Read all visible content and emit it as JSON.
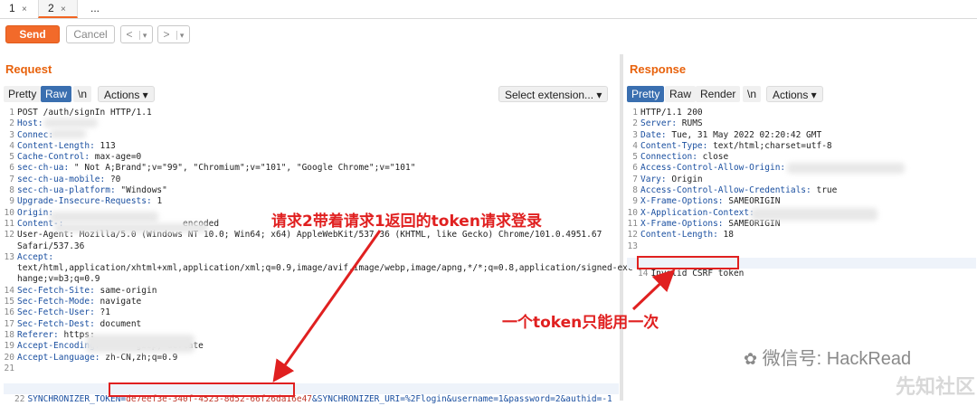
{
  "tabs": [
    {
      "label": "1",
      "close": "×"
    },
    {
      "label": "2",
      "close": "×"
    },
    {
      "label": "..."
    }
  ],
  "toolbar": {
    "send_label": "Send",
    "cancel_label": "Cancel",
    "back_glyph": "<",
    "fwd_glyph": ">",
    "menu_glyph": "▾"
  },
  "request": {
    "title": "Request",
    "view_tabs": [
      "Pretty",
      "Raw",
      "\\n"
    ],
    "actions_label": "Actions ▾",
    "select_extension_label": "Select extension... ▾",
    "lines": [
      {
        "n": "1",
        "k": "",
        "v": "POST /auth/signIn HTTP/1.1"
      },
      {
        "n": "2",
        "k": "Host",
        "v": ""
      },
      {
        "n": "3",
        "k": "Connec",
        "v": ""
      },
      {
        "n": "4",
        "k": "Content-Length",
        "v": " 113"
      },
      {
        "n": "5",
        "k": "Cache-Control",
        "v": " max-age=0"
      },
      {
        "n": "6",
        "k": "sec-ch-ua",
        "v": " \" Not A;Brand\";v=\"99\", \"Chromium\";v=\"101\", \"Google Chrome\";v=\"101\""
      },
      {
        "n": "7",
        "k": "sec-ch-ua-mobile",
        "v": " ?0"
      },
      {
        "n": "8",
        "k": "sec-ch-ua-platform",
        "v": " \"Windows\""
      },
      {
        "n": "9",
        "k": "Upgrade-Insecure-Requests",
        "v": " 1"
      },
      {
        "n": "10",
        "k": "Origin",
        "v": ""
      },
      {
        "n": "11",
        "k": "Content-",
        "v": "                       encoded"
      },
      {
        "n": "12",
        "k": "",
        "v": "User-Agent: Mozilla/5.0 (Windows NT 10.0; Win64; x64) AppleWebKit/537.36 (KHTML, like Gecko) Chrome/101.0.4951.67"
      },
      {
        "n": "",
        "k": "",
        "v": "Safari/537.36"
      },
      {
        "n": "13",
        "k": "Accept",
        "v": ""
      },
      {
        "n": "",
        "k": "",
        "v": "text/html,application/xhtml+xml,application/xml;q=0.9,image/avif,image/webp,image/apng,*/*;q=0.8,application/signed-exc"
      },
      {
        "n": "",
        "k": "",
        "v": "hange;v=b3;q=0.9"
      },
      {
        "n": "14",
        "k": "Sec-Fetch-Site",
        "v": " same-origin"
      },
      {
        "n": "15",
        "k": "Sec-Fetch-Mode",
        "v": " navigate"
      },
      {
        "n": "16",
        "k": "Sec-Fetch-User",
        "v": " ?1"
      },
      {
        "n": "17",
        "k": "Sec-Fetch-Dest",
        "v": " document"
      },
      {
        "n": "18",
        "k": "Referer",
        "v": " https:"
      },
      {
        "n": "19",
        "k": "Accept-Encoding",
        "v": "       gzip, deflate"
      },
      {
        "n": "20",
        "k": "Accept-Language",
        "v": " zh-CN,zh;q=0.9"
      },
      {
        "n": "21",
        "k": "",
        "v": ""
      }
    ],
    "last_line": {
      "n": "22",
      "key": "SYNCHRONIZER_TOKEN=",
      "token": "de7eef3e-340f-4523-8d52-66f26da16e47",
      "rest": "&SYNCHRONIZER_URI=%2Flogin&username=1&password=2&authid=-1"
    }
  },
  "response": {
    "title": "Response",
    "view_tabs": [
      "Pretty",
      "Raw",
      "Render",
      "\\n"
    ],
    "actions_label": "Actions ▾",
    "lines": [
      {
        "n": "1",
        "k": "",
        "v": "HTTP/1.1 200"
      },
      {
        "n": "2",
        "k": "Server",
        "v": " RUMS"
      },
      {
        "n": "3",
        "k": "Date",
        "v": " Tue, 31 May 2022 02:20:42 GMT"
      },
      {
        "n": "4",
        "k": "Content-Type",
        "v": " text/html;charset=utf-8"
      },
      {
        "n": "5",
        "k": "Connection",
        "v": " close"
      },
      {
        "n": "6",
        "k": "Access-Control-Allow-Origin",
        "v": ""
      },
      {
        "n": "7",
        "k": "Vary",
        "v": " Origin"
      },
      {
        "n": "8",
        "k": "Access-Control-Allow-Credentials",
        "v": " true"
      },
      {
        "n": "9",
        "k": "X-Frame-Options",
        "v": " SAMEORIGIN"
      },
      {
        "n": "10",
        "k": "X-Application-Context",
        "v": ""
      },
      {
        "n": "11",
        "k": "X-Frame-Options",
        "v": " SAMEORIGIN"
      },
      {
        "n": "12",
        "k": "Content-Length",
        "v": " 18"
      },
      {
        "n": "13",
        "k": "",
        "v": ""
      }
    ],
    "body_line": {
      "n": "14",
      "text": "Invalid CSRF token"
    }
  },
  "annotations": {
    "request_note": "请求2带着请求1返回的token请求登录",
    "response_note": "一个token只能用一次",
    "arrow_color": "#e02020"
  },
  "watermark": {
    "text": "微信号: HackRead",
    "site": "先知社区"
  }
}
